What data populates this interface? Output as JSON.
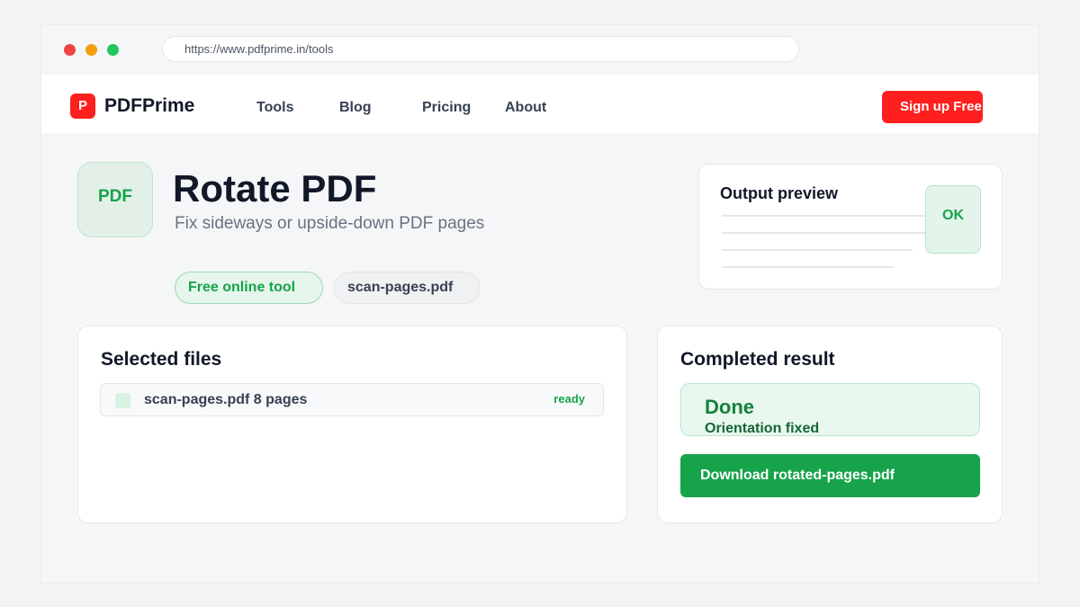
{
  "browser": {
    "url": "https://www.pdfprime.in/tools"
  },
  "navbar": {
    "logo_letter": "P",
    "brand": "PDFPrime",
    "links": [
      "Tools",
      "Blog",
      "Pricing",
      "About"
    ],
    "signup_label": "Sign up Free"
  },
  "hero": {
    "badge": "PDF",
    "title": "Rotate PDF",
    "subtitle": "Fix sideways or upside-down PDF pages",
    "pills": [
      "Free online tool",
      "scan-pages.pdf"
    ]
  },
  "preview": {
    "title": "Output preview",
    "badge": "OK"
  },
  "files": {
    "title": "Selected files",
    "items": [
      {
        "name": "scan-pages.pdf 8 pages",
        "status": "ready"
      }
    ]
  },
  "result": {
    "title": "Completed result",
    "status_title": "Done",
    "status_subtitle": "Orientation fixed",
    "download_label": "Download rotated-pages.pdf"
  },
  "colors": {
    "brand_red": "#ff1f1f",
    "success_green": "#16a34a",
    "soft_green": "#e8f8ef",
    "text_dark": "#111827",
    "text_muted": "#6b7280"
  },
  "icons": {
    "window_controls": [
      "close-dot",
      "minimize-dot",
      "maximize-dot"
    ],
    "file": "file-icon"
  }
}
